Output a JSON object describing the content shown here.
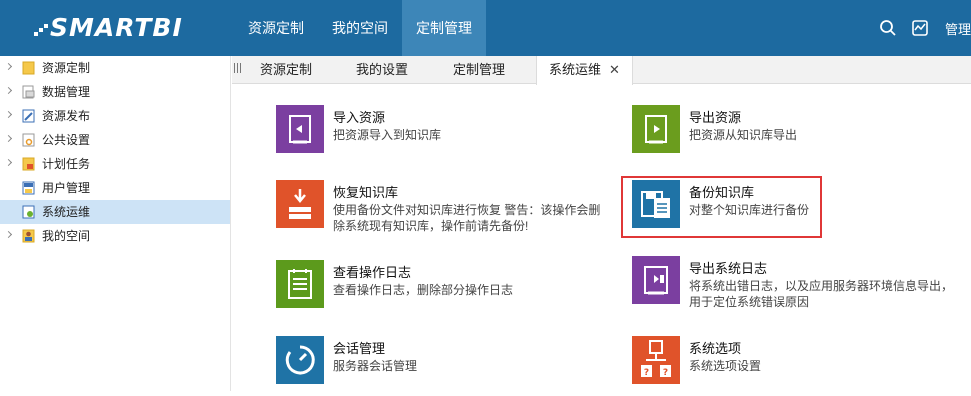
{
  "app": {
    "logo": "SMARTBI"
  },
  "topnav": {
    "items": [
      {
        "label": "资源定制"
      },
      {
        "label": "我的空间"
      },
      {
        "label": "定制管理"
      }
    ],
    "right_label": "管理"
  },
  "sidebar": {
    "items": [
      {
        "label": "资源定制",
        "icon": "folder-icon"
      },
      {
        "label": "数据管理",
        "icon": "document-icon"
      },
      {
        "label": "资源发布",
        "icon": "publish-icon"
      },
      {
        "label": "公共设置",
        "icon": "settings-doc-icon"
      },
      {
        "label": "计划任务",
        "icon": "task-icon"
      },
      {
        "label": "用户管理",
        "icon": "user-manage-icon"
      },
      {
        "label": "系统运维",
        "icon": "system-ops-icon"
      },
      {
        "label": "我的空间",
        "icon": "person-icon"
      }
    ]
  },
  "tabs": [
    {
      "label": "资源定制"
    },
    {
      "label": "我的设置"
    },
    {
      "label": "定制管理"
    },
    {
      "label": "系统运维",
      "close": "✕"
    }
  ],
  "tiles": [
    {
      "title": "导入资源",
      "desc": "把资源导入到知识库",
      "color": "#7b3fa0",
      "icon": "import-icon"
    },
    {
      "title": "导出资源",
      "desc": "把资源从知识库导出",
      "color": "#6b9d1e",
      "icon": "export-icon"
    },
    {
      "title": "恢复知识库",
      "desc": "使用备份文件对知识库进行恢复 警告：该操作会删除系统现有知识库，操作前请先备份!",
      "color": "#e0532a",
      "icon": "restore-icon"
    },
    {
      "title": "备份知识库",
      "desc": "对整个知识库进行备份",
      "color": "#1f73a6",
      "icon": "backup-icon"
    },
    {
      "title": "查看操作日志",
      "desc": "查看操作日志，删除部分操作日志",
      "color": "#5c9a1c",
      "icon": "log-icon"
    },
    {
      "title": "导出系统日志",
      "desc": "将系统出错日志，以及应用服务器环境信息导出，用于定位系统错误原因",
      "color": "#7b3fa0",
      "icon": "export-log-icon"
    },
    {
      "title": "会话管理",
      "desc": "服务器会话管理",
      "color": "#1f73a6",
      "icon": "session-icon"
    },
    {
      "title": "系统选项",
      "desc": "系统选项设置",
      "color": "#e0532a",
      "icon": "options-icon"
    }
  ]
}
